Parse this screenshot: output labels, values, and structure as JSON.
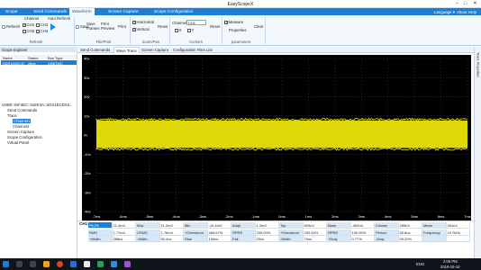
{
  "window": {
    "title": "EasyScopeX"
  },
  "menu": {
    "items": [
      "Scope",
      "Send Commands",
      "Waveform",
      "Screen Capture",
      "Scope Configuration"
    ],
    "active": "Waveform",
    "right": [
      "Language ▾",
      "About",
      "Help"
    ]
  },
  "ribbon": {
    "refresh": "Refresh",
    "channel": "Channel",
    "auto_refresh": "Auto Refresh",
    "ch": [
      "CH1",
      "CH2",
      "CH3",
      "CH4"
    ],
    "save": "Save",
    "save_frames": [
      "Save",
      "Frames"
    ],
    "print_preview": [
      "Print",
      "Preview"
    ],
    "print": "Print",
    "horizontal": "Horizontal",
    "vertical": "Vertical",
    "reset": "Reset",
    "channel_label": "Channel",
    "channel_value": "CH1",
    "x": "X",
    "y": "Y",
    "reset2": "Reset",
    "measure": "Measure",
    "properties": "Properties",
    "clear": "Clear",
    "groups": [
      "Refresh",
      "File/Print",
      "Zoom/Pan",
      "Cursors",
      "parameters"
    ]
  },
  "tabs": [
    "Send Commands",
    "Wave Trace",
    "Screen Capture",
    "Configuration Files List"
  ],
  "active_tab": "Wave Trace",
  "explorer": {
    "title": "Scope Explorer",
    "columns": [
      "Name",
      "Status",
      "Bus Type"
    ],
    "row": [
      "SDS1202X-E",
      "Alive",
      "USBTMC"
    ],
    "tree": [
      "USB0::0xF4EC::0xEE3A::SDS1ECDX3...",
      "Send Commands",
      "Trace",
      "Channel1",
      "Channel2",
      "Screen Capture",
      "Scope Configuration",
      "Virtual Panel"
    ]
  },
  "right_rail": "Trace Properties",
  "scope": {
    "y_ticks": [
      "40v",
      "30v",
      "20v",
      "10v",
      "0v",
      "-10v",
      "-20v",
      "-30v",
      "-40v"
    ],
    "x_ticks": [
      "-7ms",
      "-6ms",
      "-5ms",
      "-4ms",
      "-3ms",
      "-2ms",
      "-1ms",
      "0ms",
      "1ms",
      "2ms",
      "3ms",
      "4ms",
      "5ms",
      "6ms",
      "7ms"
    ],
    "trace_color": "#f2ea0a",
    "trace_center_v": 0,
    "trace_band_v": [
      -6.8,
      7.6
    ]
  },
  "measurements": {
    "channel": "CH1",
    "rows": [
      [
        "Pk-Pk",
        "21.4mV",
        "Max",
        "11.2mV",
        "Min",
        "-10.4mV",
        "Ampl",
        "1.2mV",
        "Top",
        "800uV",
        "Base",
        "-400uV",
        "Cmean",
        "285uV",
        "Mean",
        "281uV"
      ],
      [
        "RMS",
        "1.77mV",
        "CRMS",
        "1.76mV",
        "+Overshoot",
        "466.67%",
        "RPRE",
        "200.00%",
        "+Overshoot",
        "200.00%",
        "RPRE",
        "150.00%",
        "Period",
        "50.8us",
        "Frequency",
        "19.7kHz"
      ],
      [
        "+Width",
        "388ns",
        "-Width",
        "50.4us",
        "Rise",
        "160ns",
        "Fall",
        "20ns",
        "-Width",
        "70ns",
        "+Duty",
        "0.77%",
        "-Duty",
        "99.22%",
        "",
        ""
      ]
    ]
  },
  "taskbar": {
    "time": "2:05 PM",
    "date": "2019-10-10",
    "lang": "ENG"
  }
}
